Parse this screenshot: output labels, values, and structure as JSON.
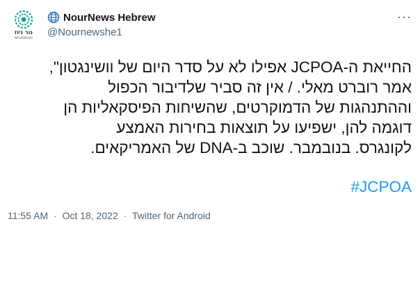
{
  "tweet": {
    "display_name": "NourNews Hebrew",
    "handle": "@Nournewshe1",
    "avatar_text": "נור ניוז",
    "avatar_subtext": "NOURNEWS",
    "more_label": "···",
    "body_lines": [
      "החייאת ה-JCPOA אפילו לא על סדר היום של וושינגטון\",",
      "אמר רוברט מאלי. / אין זה סביר שלדיבור הכפול",
      "וההתנהגות של הדמוקרטים, שהשיחות הפיסקאליות הן",
      "דוגמה להן, ישפיעו על תוצאות בחירות האמצע",
      "לקונגרס. בנובמבר. שוכב ב-DNA של האמריקאים."
    ],
    "hashtag": "#JCPOA",
    "time": "11:55 AM",
    "date": "Oct 18, 2022",
    "source": "Twitter for Android",
    "separator": "·"
  },
  "colors": {
    "accent": "#1d9bf0",
    "secondary_text": "#536471",
    "primary_text": "#0f1419",
    "logo_green": "#1aa38f"
  }
}
